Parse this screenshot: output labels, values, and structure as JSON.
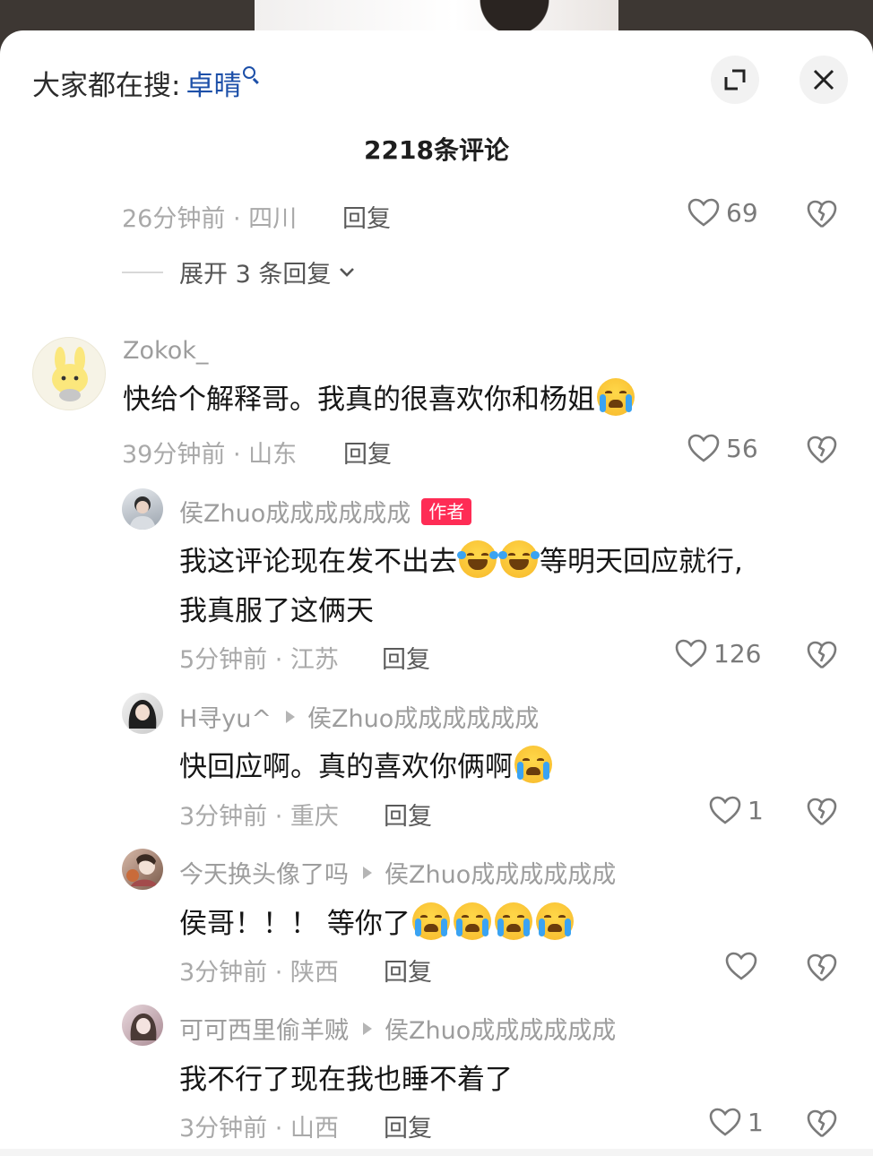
{
  "header": {
    "search_prefix": "大家都在搜:",
    "search_keyword": "卓晴",
    "comment_count_title": "2218条评论"
  },
  "colors": {
    "link_blue": "#1c4fa8",
    "author_badge": "#fe2c55",
    "meta_gray": "#a9a9a9"
  },
  "prev_comment": {
    "meta": "26分钟前 · 四川",
    "reply_label": "回复",
    "likes": "69",
    "expand_label": "展开 3 条回复"
  },
  "comments": [
    {
      "username": "Zokok_",
      "text": "快给个解释哥。我真的很喜欢你和杨姐",
      "emojis": [
        "cry"
      ],
      "meta": "39分钟前 · 山东",
      "reply_label": "回复",
      "likes": "56"
    },
    {
      "username": "侯Zhuo成成成成成成",
      "badge": "作者",
      "text_line1": "我这评论现在发不出去",
      "text_line1_after": "等明天回应就行,",
      "text_line2": "我真服了这俩天",
      "emojis": [
        "laugh-cry",
        "laugh-cry"
      ],
      "meta": "5分钟前 · 江苏",
      "reply_label": "回复",
      "likes": "126"
    },
    {
      "username": "H寻yu^",
      "reply_to": "侯Zhuo成成成成成成",
      "text": "快回应啊。真的喜欢你俩啊",
      "emojis": [
        "cry"
      ],
      "meta": "3分钟前 · 重庆",
      "reply_label": "回复",
      "likes": "1"
    },
    {
      "username": "今天换头像了吗",
      "reply_to": "侯Zhuo成成成成成成",
      "text": "侯哥！！！ 等你了",
      "emojis": [
        "cry",
        "cry",
        "cry",
        "cry"
      ],
      "meta": "3分钟前 · 陕西",
      "reply_label": "回复",
      "likes": ""
    },
    {
      "username": "可可西里偷羊贼",
      "reply_to": "侯Zhuo成成成成成成",
      "text": "我不行了现在我也睡不着了",
      "emojis": [],
      "meta": "3分钟前 · 山西",
      "reply_label": "回复",
      "likes": "1"
    }
  ]
}
